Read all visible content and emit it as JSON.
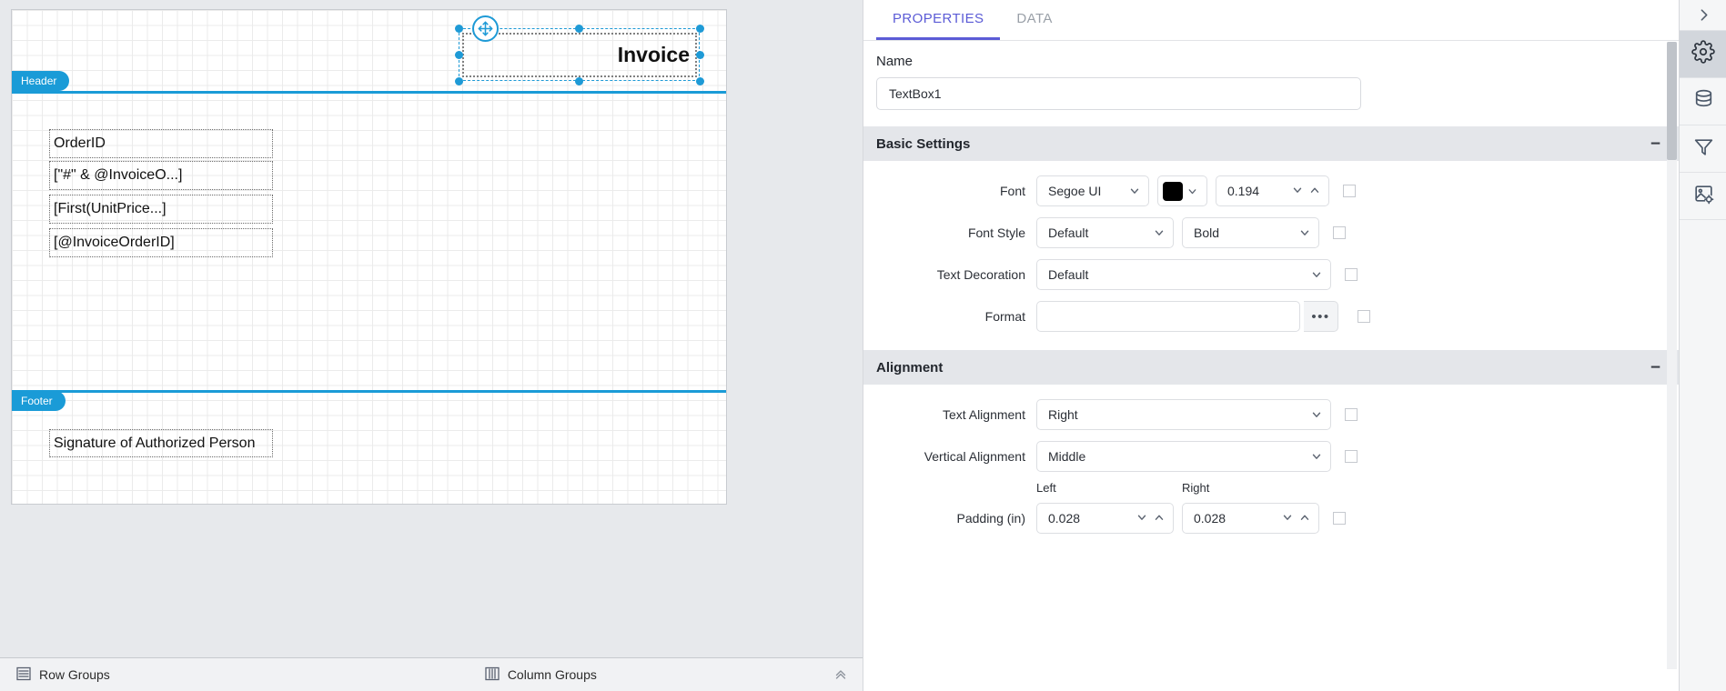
{
  "designer": {
    "bands": [
      {
        "name": "header-band",
        "label": "Header"
      },
      {
        "name": "footer-band",
        "label": "Footer"
      }
    ],
    "selected_element": {
      "text": "Invoice",
      "move_icon": "move-cross-icon"
    },
    "report_items": [
      {
        "label": "OrderID"
      },
      {
        "label": "[\"#\" & @InvoiceO...]"
      },
      {
        "label": "[First(UnitPrice...]"
      },
      {
        "label": "[@InvoiceOrderID]"
      },
      {
        "label": "Signature of Authorized Person"
      }
    ]
  },
  "groups_bar": {
    "row_groups_label": "Row Groups",
    "row_groups_icon": "row-groups-icon",
    "column_groups_label": "Column Groups",
    "column_groups_icon": "column-groups-icon",
    "collapse_icon": "chevron-double-up-icon"
  },
  "properties_panel": {
    "tabs": [
      {
        "label": "PROPERTIES",
        "active": true
      },
      {
        "label": "DATA",
        "active": false
      }
    ],
    "name": {
      "label": "Name",
      "value": "TextBox1"
    },
    "sections": [
      {
        "title": "Basic Settings",
        "collapse_mark": "−",
        "rows": [
          {
            "label": "Font",
            "font_family": "Segoe UI",
            "font_color": "#000000",
            "font_size": "0.194"
          },
          {
            "label": "Font Style",
            "style": "Default",
            "weight": "Bold"
          },
          {
            "label": "Text Decoration",
            "value": "Default"
          },
          {
            "label": "Format",
            "value": "",
            "ellipsis": "•••"
          }
        ]
      },
      {
        "title": "Alignment",
        "collapse_mark": "−",
        "rows": [
          {
            "label": "Text Alignment",
            "value": "Right"
          },
          {
            "label": "Vertical Alignment",
            "value": "Middle"
          },
          {
            "label": "Padding (in)",
            "sub_label_left": "Left",
            "sub_label_right": "Right",
            "value_left": "0.028",
            "value_right": "0.028"
          }
        ]
      }
    ]
  },
  "icon_rail": {
    "collapse_icon": "chevron-right-icon",
    "buttons": [
      {
        "icon": "gear-icon",
        "active": true
      },
      {
        "icon": "database-icon",
        "active": false
      },
      {
        "icon": "filter-icon",
        "active": false
      },
      {
        "icon": "image-settings-icon",
        "active": false
      }
    ]
  },
  "colors": {
    "accent_blue": "#1a9bd7",
    "tab_active": "#5b5bd6",
    "selection": "#1e9ad6"
  }
}
